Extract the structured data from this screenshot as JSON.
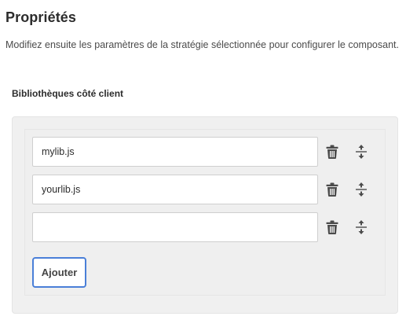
{
  "header": {
    "title": "Propriétés",
    "description": "Modifiez ensuite les paramètres de la stratégie sélectionnée pour configurer le composant."
  },
  "section": {
    "label": "Bibliothèques côté client"
  },
  "libraries": {
    "items": [
      {
        "value": "mylib.js",
        "placeholder": ""
      },
      {
        "value": "yourlib.js",
        "placeholder": ""
      },
      {
        "value": "",
        "placeholder": ""
      }
    ],
    "add_label": "Ajouter"
  },
  "icons": {
    "delete": "trash-icon",
    "move": "reorder-icon"
  },
  "colors": {
    "focus_border": "#4a7fd8",
    "panel_background": "#f0f0f0",
    "icon": "#4b4b4b"
  }
}
